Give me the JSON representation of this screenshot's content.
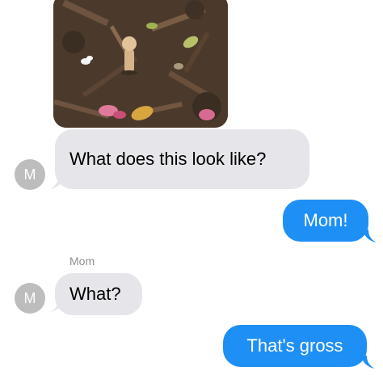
{
  "colors": {
    "incoming_bubble": "#e5e5ea",
    "outgoing_bubble": "#1e8ff5",
    "avatar": "#bdbdbd",
    "sender_name": "#8e8e93"
  },
  "thread": {
    "photo": {
      "icon": "garden-mulch-photo"
    },
    "messages": [
      {
        "direction": "incoming",
        "avatar_initial": "M",
        "text": "What does this look like?"
      },
      {
        "direction": "outgoing",
        "text": "Mom!"
      },
      {
        "direction": "incoming",
        "sender": "Mom",
        "avatar_initial": "M",
        "text": "What?"
      },
      {
        "direction": "outgoing",
        "text": "That's gross"
      }
    ]
  }
}
